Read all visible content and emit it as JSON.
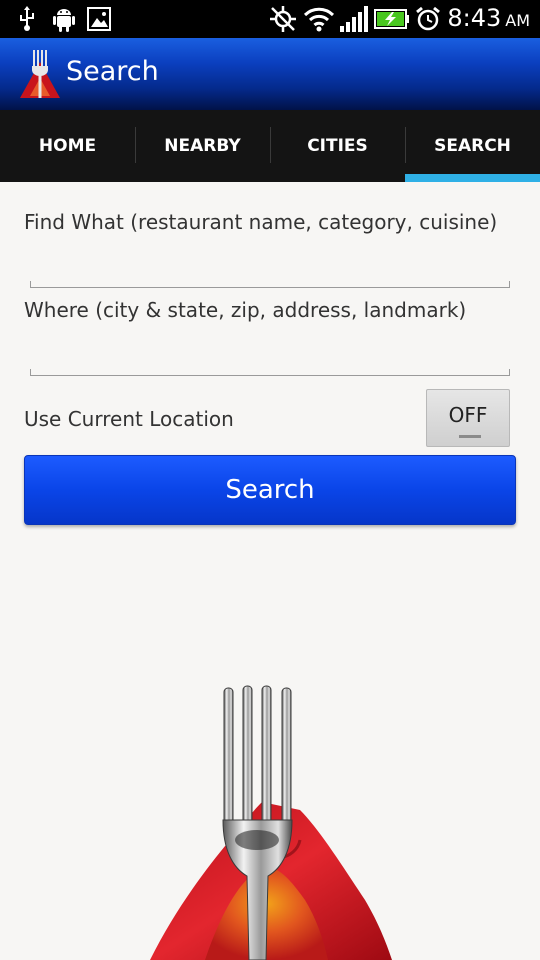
{
  "status_bar": {
    "time": "8:43",
    "ampm": "AM",
    "icons": [
      "usb-icon",
      "android-debug-icon",
      "gallery-icon",
      "gps-off-icon",
      "wifi-icon",
      "signal-icon",
      "battery-charging-icon",
      "alarm-icon"
    ]
  },
  "action_bar": {
    "title": "Search",
    "logo_icon": "fork-napkin-logo-icon"
  },
  "tabs": [
    {
      "label": "HOME"
    },
    {
      "label": "NEARBY"
    },
    {
      "label": "CITIES"
    },
    {
      "label": "SEARCH",
      "active": true
    }
  ],
  "form": {
    "find_label": "Find What (restaurant name, category, cuisine)",
    "find_value": "",
    "where_label": "Where (city & state, zip, address, landmark)",
    "where_value": "",
    "location_label": "Use Current Location",
    "location_toggle": "OFF",
    "search_button": "Search"
  },
  "colors": {
    "accent_tab": "#2fb0e6",
    "button_blue": "#0a45e8",
    "napkin_red": "#d8222a"
  }
}
